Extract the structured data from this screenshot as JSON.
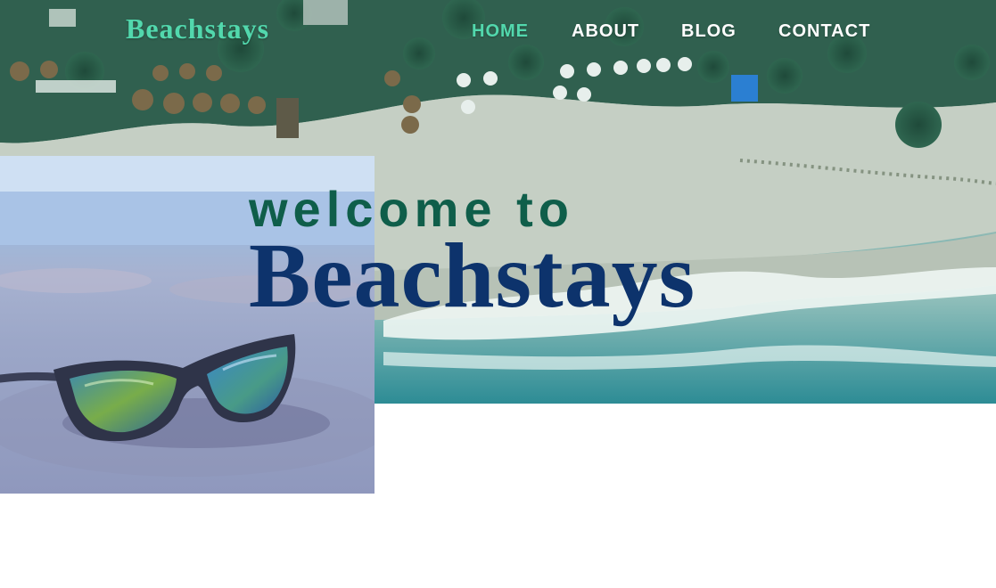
{
  "brand": {
    "name": "Beachstays",
    "color": "#52d8ad"
  },
  "nav": {
    "items": [
      {
        "label": "HOME",
        "active": true
      },
      {
        "label": "ABOUT",
        "active": false
      },
      {
        "label": "BLOG",
        "active": false
      },
      {
        "label": "CONTACT",
        "active": false
      }
    ],
    "active_color": "#52d8ad",
    "text_color": "#ffffff"
  },
  "hero": {
    "welcome_text": "welcome to",
    "title": "Beachstays",
    "welcome_color": "#0f5e4a",
    "title_color": "#0d336c",
    "background_image": "aerial-beach-photo"
  },
  "feature_image": {
    "subject": "sunglasses-on-sand-photo"
  }
}
